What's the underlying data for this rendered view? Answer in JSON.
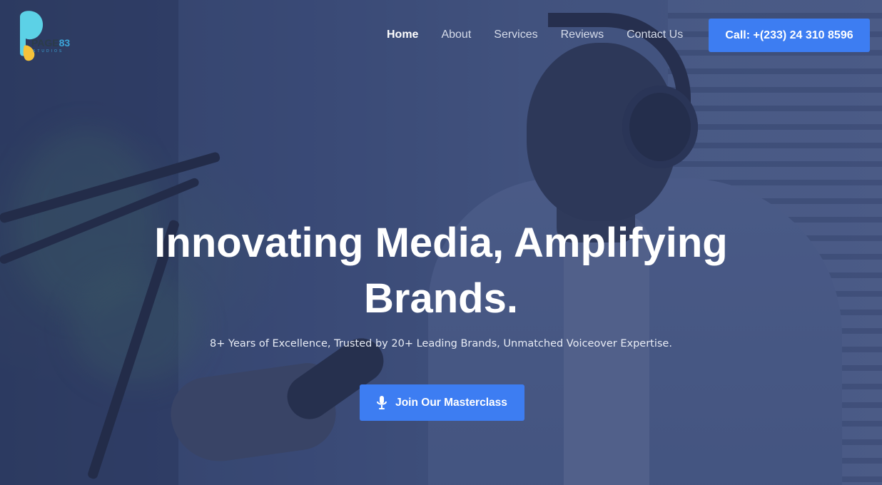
{
  "brand": {
    "logo_text": "PAGE",
    "logo_number": "83",
    "logo_sub": "STUDIOS"
  },
  "nav": {
    "items": [
      {
        "label": "Home",
        "active": true
      },
      {
        "label": "About",
        "active": false
      },
      {
        "label": "Services",
        "active": false
      },
      {
        "label": "Reviews",
        "active": false
      },
      {
        "label": "Contact Us",
        "active": false
      }
    ]
  },
  "header": {
    "call_label": "Call: +(233) 24 310 8596"
  },
  "hero": {
    "title_line1": "Innovating Media, Amplifying",
    "title_line2": "Brands.",
    "subtitle": "8+ Years of Excellence, Trusted by 20+ Leading Brands, Unmatched Voiceover Expertise.",
    "cta_label": "Join Our Masterclass",
    "cta_icon": "microphone-icon"
  },
  "colors": {
    "accent": "#3d7df2",
    "overlay": "#3a4e80",
    "logo_cyan": "#3ca6d9",
    "logo_yellow": "#f5c23a"
  }
}
